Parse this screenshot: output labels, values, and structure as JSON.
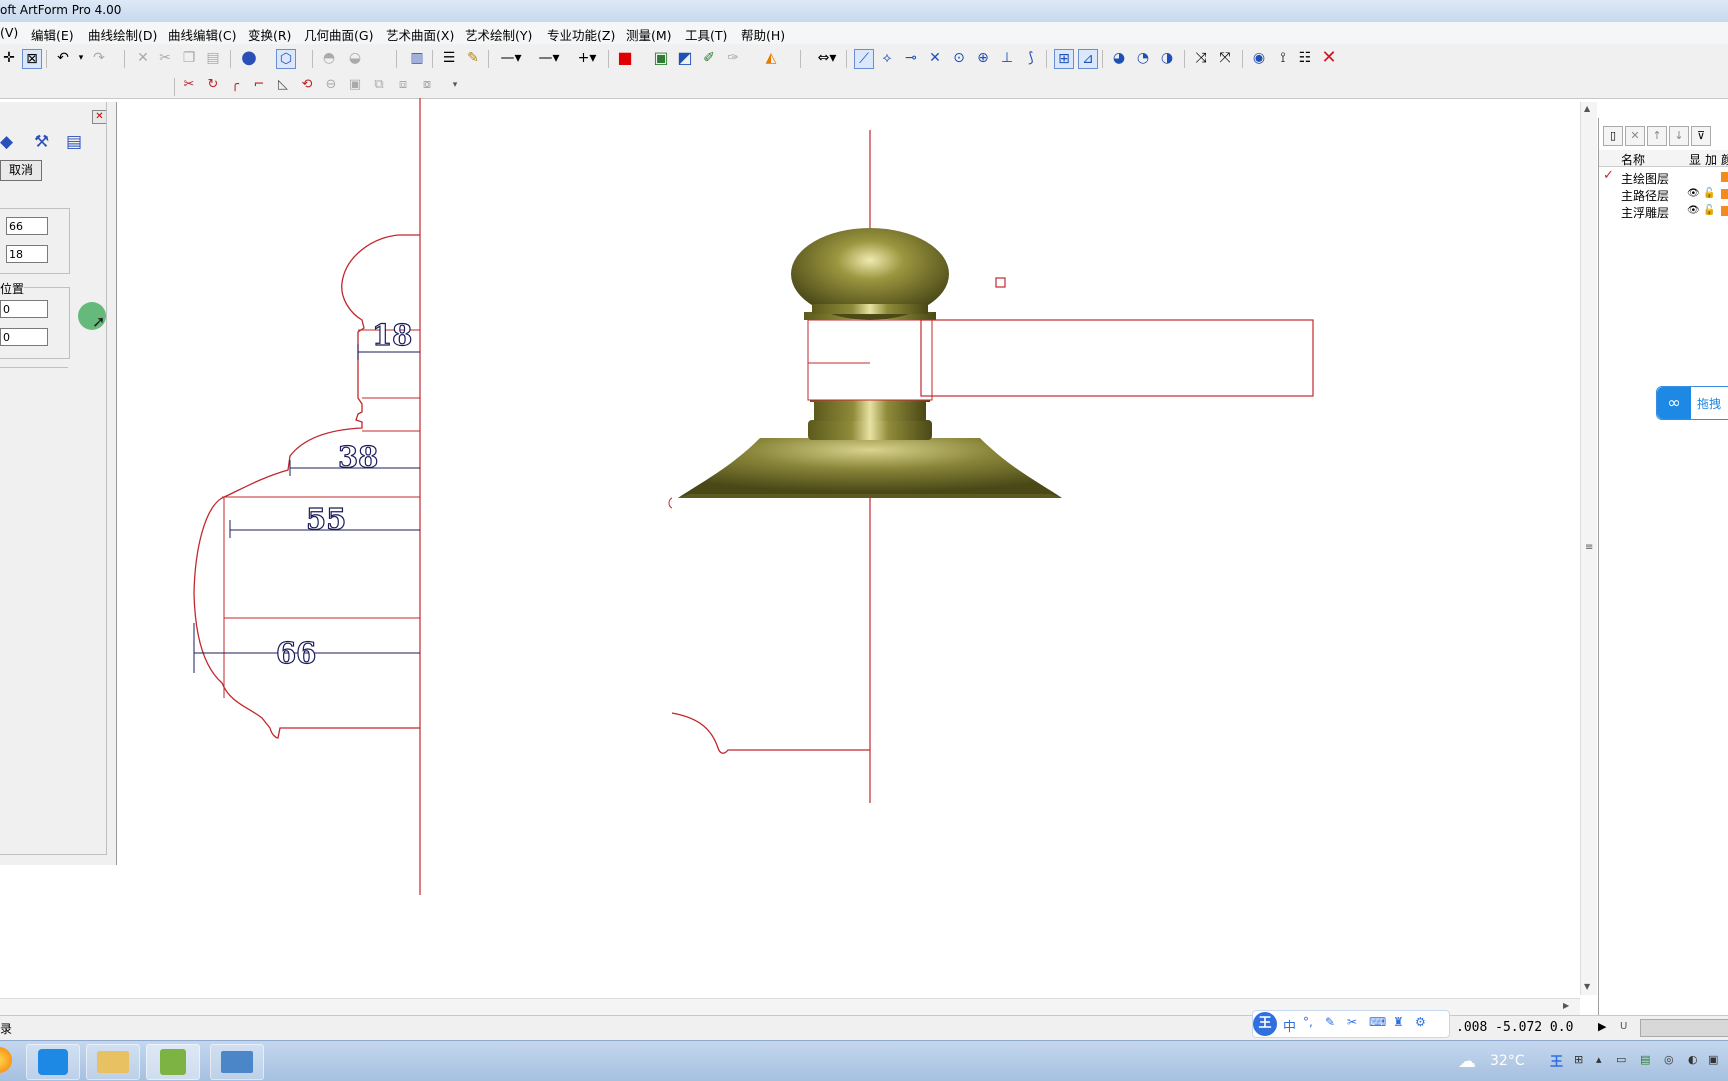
{
  "window": {
    "title": "oft ArtForm Pro 4.00"
  },
  "menu": [
    "(V)",
    "编辑(E)",
    "曲线绘制(D)",
    "曲线编辑(C)",
    "变换(R)",
    "几何曲面(G)",
    "艺术曲面(X)",
    "艺术绘制(Y)",
    "专业功能(Z)",
    "测量(M)",
    "工具(T)",
    "帮助(H)"
  ],
  "left_panel": {
    "cancel_label": "取消",
    "field1": "66",
    "field2": "18",
    "position_label": "位置",
    "pos_x": "0",
    "pos_y": "0"
  },
  "drawing": {
    "dimensions": [
      "18",
      "38",
      "55",
      "66"
    ]
  },
  "layers": {
    "headers": [
      "名称",
      "显",
      "加",
      "颜"
    ],
    "items": [
      "主绘图层",
      "主路径层",
      "主浮雕层"
    ],
    "colors": {
      "layer_swatch": "#f28c1e",
      "curve": "#c0282d",
      "dimension": "#1b1b5a",
      "model": "#7d7a2e"
    }
  },
  "floating_badge": "拖拽",
  "status": {
    "left_text": "录",
    "coords": ".008 -5.072 0.0",
    "unit": "U"
  },
  "ime": {
    "label": "王",
    "mode": "中"
  },
  "tray": {
    "temperature": "32°C",
    "ime_label": "王"
  }
}
